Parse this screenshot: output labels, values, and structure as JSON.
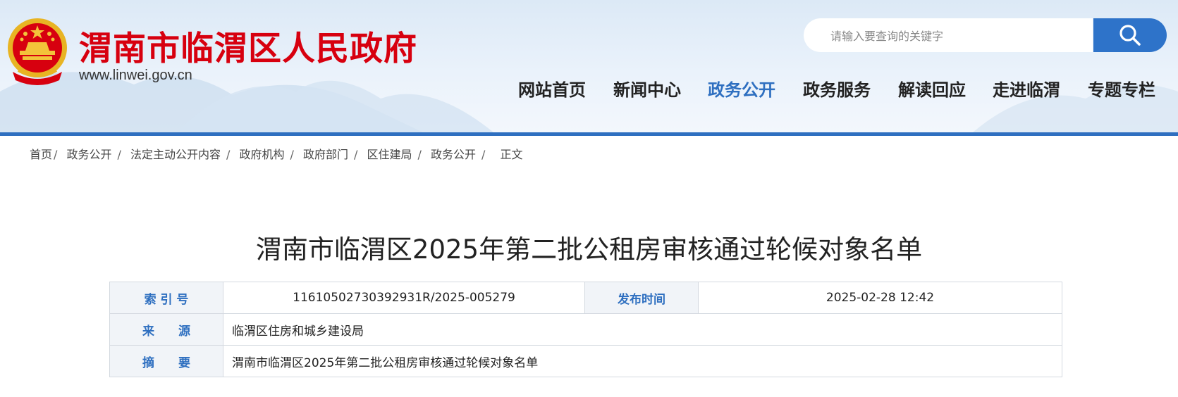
{
  "site": {
    "title": "渭南市临渭区人民政府",
    "url": "www.linwei.gov.cn",
    "brand_color": "#d7000f",
    "accent_color": "#2e6fc0"
  },
  "search": {
    "placeholder": "请输入要查询的关键字",
    "button_icon": "search-icon"
  },
  "nav": {
    "items": [
      {
        "label": "网站首页",
        "active": false
      },
      {
        "label": "新闻中心",
        "active": false
      },
      {
        "label": "政务公开",
        "active": true
      },
      {
        "label": "政务服务",
        "active": false
      },
      {
        "label": "解读回应",
        "active": false
      },
      {
        "label": "走进临渭",
        "active": false
      },
      {
        "label": "专题专栏",
        "active": false
      }
    ]
  },
  "breadcrumb": {
    "items": [
      "首页",
      "政务公开",
      "法定主动公开内容",
      "政府机构",
      "政府部门",
      "区住建局",
      "政务公开",
      "正文"
    ]
  },
  "article": {
    "title": "渭南市临渭区2025年第二批公租房审核通过轮候对象名单",
    "meta": {
      "index_label": "索 引 号",
      "index_value": "11610502730392931R/2025-005279",
      "publish_label": "发布时间",
      "publish_value": "2025-02-28 12:42",
      "source_label": "来　　源",
      "source_value": "临渭区住房和城乡建设局",
      "summary_label": "摘　　要",
      "summary_value": "渭南市临渭区2025年第二批公租房审核通过轮候对象名单"
    }
  }
}
